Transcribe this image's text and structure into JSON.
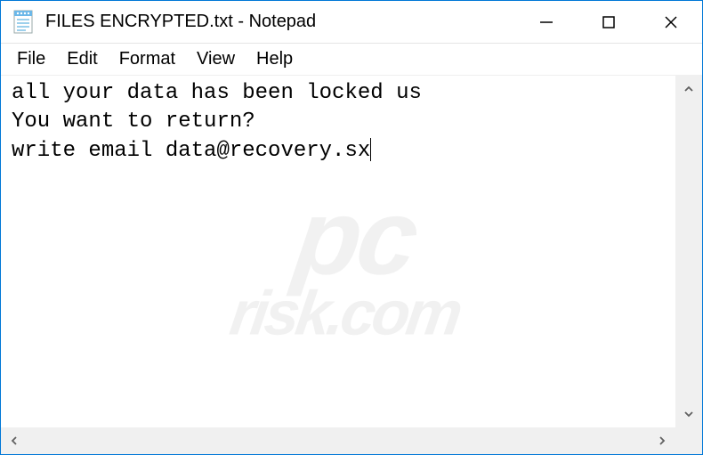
{
  "titlebar": {
    "title": "FILES ENCRYPTED.txt - Notepad"
  },
  "menubar": {
    "items": [
      {
        "label": "File"
      },
      {
        "label": "Edit"
      },
      {
        "label": "Format"
      },
      {
        "label": "View"
      },
      {
        "label": "Help"
      }
    ]
  },
  "editor": {
    "content": "all your data has been locked us\nYou want to return?\nwrite email data@recovery.sx"
  },
  "watermark": {
    "line1": "pc",
    "line2": "risk.com"
  }
}
